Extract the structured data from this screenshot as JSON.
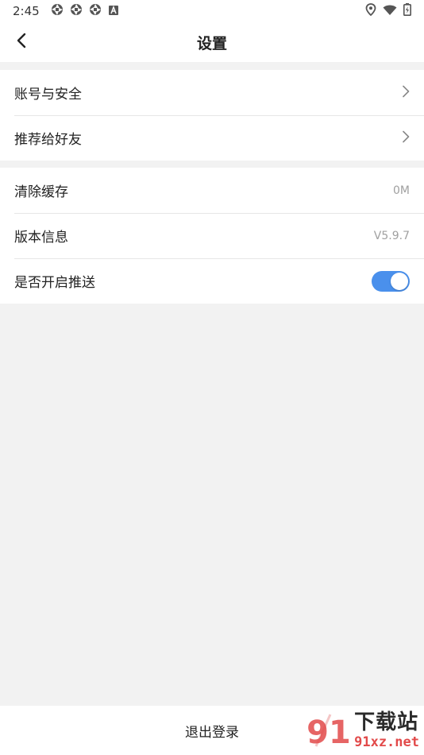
{
  "status_bar": {
    "time": "2:45",
    "left_icons": [
      "aperture-icon",
      "aperture-icon",
      "aperture-icon",
      "a-badge-icon"
    ],
    "right_icons": [
      "location-icon",
      "wifi-icon",
      "battery-icon"
    ]
  },
  "header": {
    "title": "设置",
    "back_icon": "chevron-left-icon"
  },
  "groups": {
    "account": {
      "items": [
        {
          "label": "账号与安全",
          "icon": "chevron-right-icon"
        },
        {
          "label": "推荐给好友",
          "icon": "chevron-right-icon"
        }
      ]
    },
    "app": {
      "items": [
        {
          "label": "清除缓存",
          "value": "0M"
        },
        {
          "label": "版本信息",
          "value": "V5.9.7"
        },
        {
          "label": "是否开启推送",
          "toggle": true
        }
      ]
    }
  },
  "footer": {
    "logout_label": "退出登录"
  },
  "watermark": {
    "logo_text": "91",
    "title": "下载站",
    "url": "91xz.net"
  },
  "colors": {
    "accent": "#4a90ec",
    "background": "#f2f2f2",
    "watermark_red": "#e24a4a"
  }
}
